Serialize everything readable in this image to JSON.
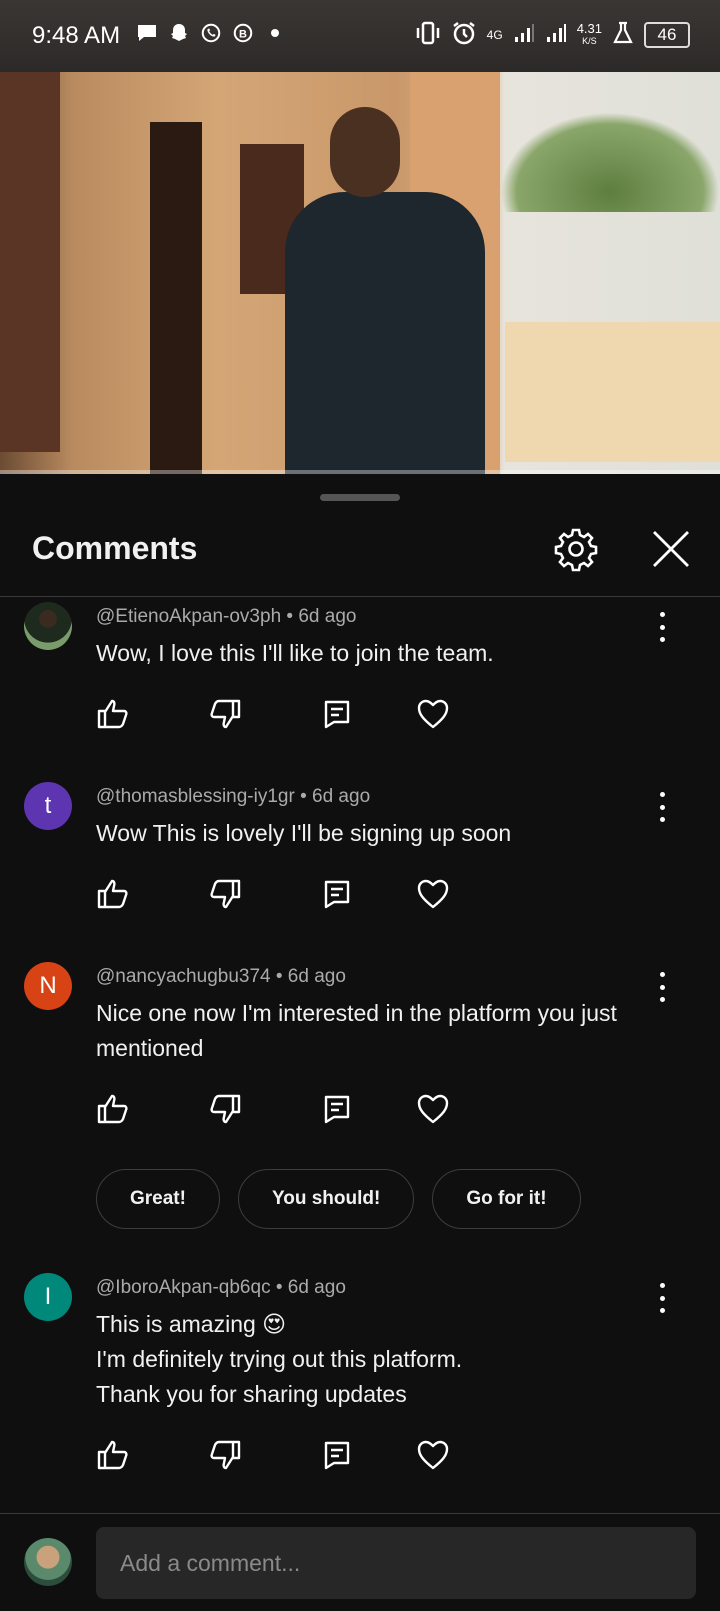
{
  "status_bar": {
    "time": "9:48 AM",
    "network": "4G",
    "speed_value": "4.31",
    "speed_unit": "K/S",
    "battery": "46",
    "notification_icons": [
      "message-icon",
      "snapchat-icon",
      "whatsapp-icon",
      "business-icon"
    ]
  },
  "sheet": {
    "title": "Comments"
  },
  "comments": [
    {
      "meta": "@EtienoAkpan-ov3ph • 6d ago",
      "lines": [
        "Wow, I love this I'll like to join the team."
      ],
      "avatar_letter": "",
      "avatar_color": "#2e3b2a"
    },
    {
      "meta": "@thomasblessing-iy1gr • 6d ago",
      "lines": [
        "Wow This is lovely I'll be signing up soon"
      ],
      "avatar_letter": "t",
      "avatar_color": "#5e35b1"
    },
    {
      "meta": "@nancyachugbu374 • 6d ago",
      "lines": [
        "Nice one now I'm interested in the platform you just",
        "mentioned"
      ],
      "avatar_letter": "N",
      "avatar_color": "#d84315"
    },
    {
      "meta": "@IboroAkpan-qb6qc • 6d ago",
      "lines": [
        "This is amazing 😍",
        "I'm definitely trying out this platform.",
        "Thank you for sharing updates"
      ],
      "avatar_letter": "I",
      "avatar_color": "#00897b"
    }
  ],
  "reply_chips": [
    "Great!",
    "You should!",
    "Go for it!"
  ],
  "composer": {
    "placeholder": "Add a comment..."
  },
  "colors": {
    "background": "#0f0f0f",
    "text": "#f1f1f1",
    "meta_text": "#aaaaaa",
    "input_bg": "#272727"
  }
}
